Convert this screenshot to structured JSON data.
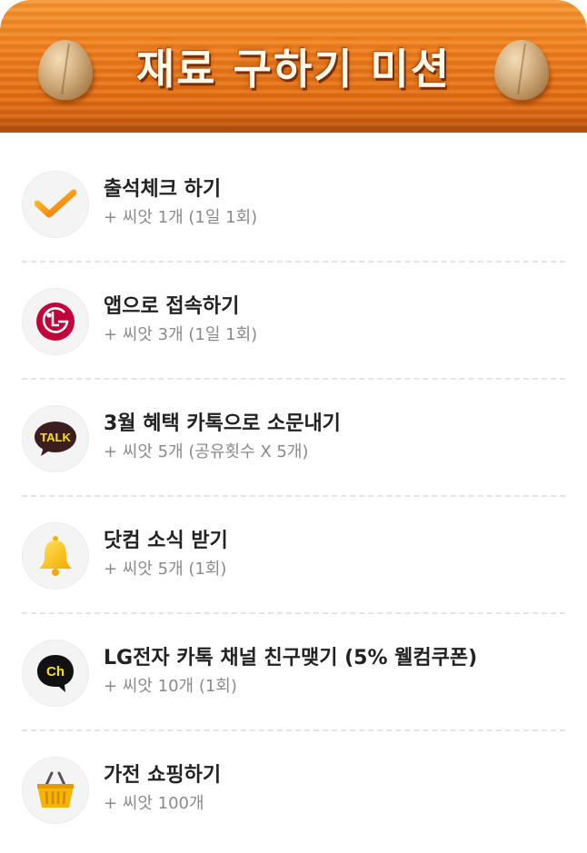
{
  "header": {
    "title": "재료 구하기 미션",
    "decor_icon": "seed-icon"
  },
  "missions": [
    {
      "icon": "checkmark-icon",
      "title": "출석체크 하기",
      "reward": "+ 씨앗 1개 (1일 1회)"
    },
    {
      "icon": "lg-logo-icon",
      "title": "앱으로 접속하기",
      "reward": "+ 씨앗 3개 (1일 1회)"
    },
    {
      "icon": "kakaotalk-icon",
      "icon_text": "TALK",
      "title": "3월 혜택 카톡으로 소문내기",
      "reward": "+ 씨앗 5개 (공유횟수 X 5개)"
    },
    {
      "icon": "bell-icon",
      "title": "닷컴 소식 받기",
      "reward": "+ 씨앗 5개 (1회)"
    },
    {
      "icon": "kakao-channel-icon",
      "icon_text": "Ch",
      "title": "LG전자 카톡 채널 친구맺기 (5% 웰컴쿠폰)",
      "reward": "+ 씨앗 10개 (1회)"
    },
    {
      "icon": "shopping-basket-icon",
      "title": "가전 쇼핑하기",
      "reward": "+ 씨앗 100개"
    }
  ],
  "colors": {
    "header_orange": "#ee7a17",
    "title_text": "#fff8ec",
    "item_title": "#222222",
    "item_sub": "#8a8a8a",
    "lg_red": "#c2033b",
    "kakao_yellow": "#fbe30a",
    "check_orange": "#f7941d"
  }
}
